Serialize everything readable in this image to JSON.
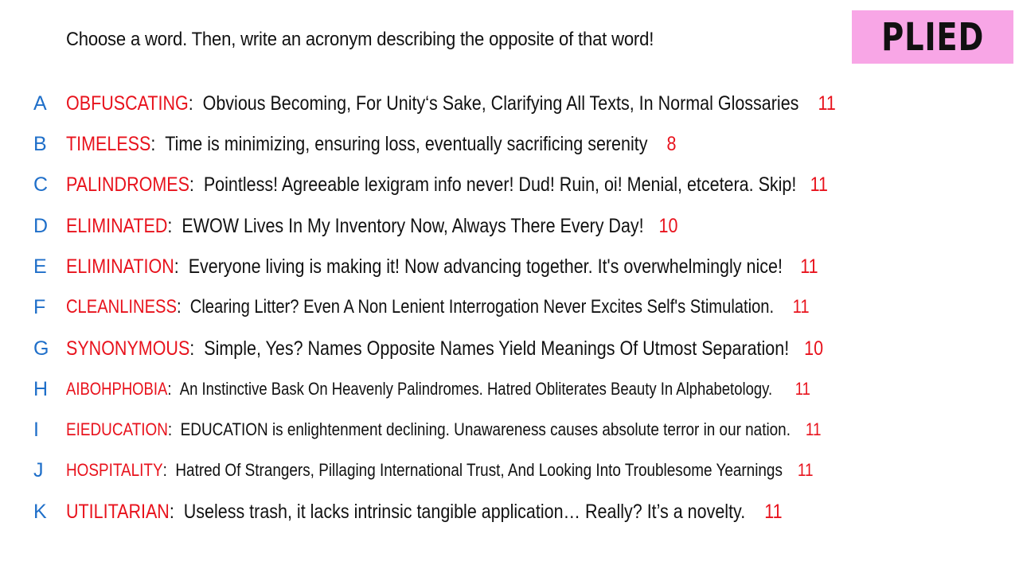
{
  "prompt": "Choose a word. Then, write an acronym describing the opposite of that word!",
  "badge": "PLIED",
  "colors": {
    "letter": "#1f6fc9",
    "word": "#e8121c",
    "score": "#e8121c",
    "badge_bg": "#f8a6e6"
  },
  "entries": [
    {
      "letter": "A",
      "word": "OBFUSCATING",
      "acronym": "Obvious Becoming, For Unity‘s Sake, Clarifying All Texts, In Normal Glossaries",
      "score": "11"
    },
    {
      "letter": "B",
      "word": "TIMELESS",
      "acronym": "Time is minimizing, ensuring loss,  eventually sacrificing serenity",
      "score": "8"
    },
    {
      "letter": "C",
      "word": "PALINDROMES",
      "acronym": "Pointless! Agreeable lexigram info never! Dud! Ruin, oi! Menial, etcetera. Skip!",
      "score": "11"
    },
    {
      "letter": "D",
      "word": "ELIMINATED",
      "acronym": "EWOW Lives In My Inventory Now, Always There Every Day!",
      "score": "10"
    },
    {
      "letter": "E",
      "word": "ELIMINATION",
      "acronym": "Everyone living is making it! Now advancing together. It's overwhelmingly nice!",
      "score": "11"
    },
    {
      "letter": "F",
      "word": "CLEANLINESS",
      "acronym": "Clearing Litter? Even A Non Lenient Interrogation Never Excites Self's Stimulation.",
      "score": "11"
    },
    {
      "letter": "G",
      "word": "SYNONYMOUS",
      "acronym": "Simple, Yes? Names Opposite Names Yield Meanings Of Utmost Separation!",
      "score": "10"
    },
    {
      "letter": "H",
      "word": "AIBOHPHOBIA",
      "acronym": "An Instinctive Bask On Heavenly Palindromes. Hatred Obliterates Beauty In Alphabetology.",
      "score": "11"
    },
    {
      "letter": "I",
      "word": "EIEDUCATION",
      "acronym": "EDUCATION is enlightenment declining. Unawareness causes absolute terror in our nation.",
      "score": "11"
    },
    {
      "letter": "J",
      "word": "HOSPITALITY",
      "acronym": "Hatred Of Strangers, Pillaging International Trust, And Looking Into Troublesome Yearnings",
      "score": "11"
    },
    {
      "letter": "K",
      "word": "UTILITARIAN",
      "acronym": "Useless trash, it lacks intrinsic tangible application… Really? It’s a novelty.",
      "score": "11"
    }
  ]
}
